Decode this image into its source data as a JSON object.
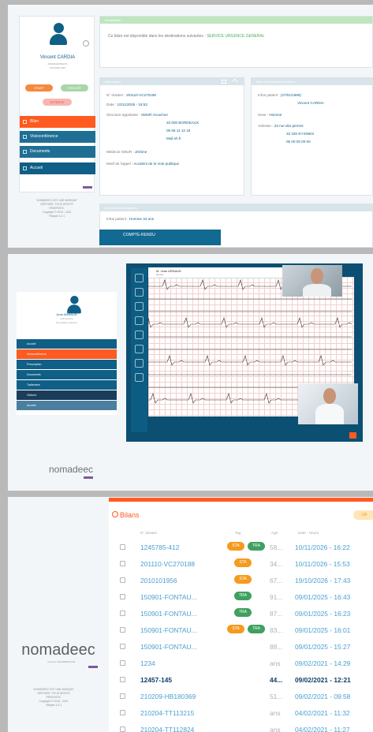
{
  "panel1": {
    "user": {
      "name": "Vincent CARDIA",
      "sub1": "ADDDEHERSHOS",
      "sub2": "INHASNE 2MS"
    },
    "badges": {
      "staff": "STAFF",
      "proute": "PROUTE",
      "attente": "ATTENTE"
    },
    "nav": [
      "Bilan",
      "Visioconférence",
      "Documents",
      "Accueil"
    ],
    "legal": [
      "NOMADEEC EST UNE MARQUE",
      "DÉPOSÉE. TOUS DROITS",
      "RÉSERVÉS.",
      "Copyright © 2015 - 2021",
      "Tellipart 1.0.1"
    ],
    "destination": {
      "header": "Destination",
      "text": "Ce bilan est disponible dans les destinations suivantes :",
      "value": "SERVICE URGENCE GENERAL"
    },
    "bilan": {
      "header": "Bilan appel",
      "dossier_label": "N° dossier :",
      "dossier": "201110-VC270188",
      "date_label": "Date :",
      "date": "10/11/2026 - 15:53",
      "structure_label": "Structure appelante :",
      "structure_lines": [
        "SMUR Arcachon",
        "33 000 BORDEAUX",
        "05 56 11 12 18",
        "Mail.sh.fr"
      ],
      "medecin_label": "Médecin SMUR :",
      "medecin": "Jérôme",
      "motif_label": "Motif de l'appel :",
      "motif": "Accident de la Voie publique"
    },
    "admin": {
      "header": "Infos administratives patient",
      "infos_label": "Infos patient :",
      "infos": "(27/01/1986)",
      "name": "Vincent CARDIA",
      "sexe_label": "Sexe :",
      "sexe": "Homme",
      "adresse_label": "Adresse :",
      "adresse_lines": [
        "23 rue des pierres",
        "33 320 EYSINES",
        "05 00 00 00 00"
      ]
    },
    "medical": {
      "header": "Infos médicales patient",
      "infos_label": "Infos patient :",
      "infos": "Homme 34 ans"
    },
    "compte_rendu": "COMPTE-RENDU"
  },
  "panel2": {
    "user": {
      "name": "Jean ARNAUD",
      "sub1": "Infirmier/ère",
      "sub2": "Nomadeec Urgence"
    },
    "nav": [
      "Accueil",
      "Visioconférence",
      "Prescription",
      "Documents",
      "Traitement",
      "Clôturer",
      "Accueil"
    ],
    "patient_name": "M. Jean ARNAUD",
    "patient_sub": "34 ans",
    "logo": "nomadeec"
  },
  "panel3": {
    "logo": "nomadeec",
    "logo_sub": "Express TELEMEDECINE",
    "legal": [
      "NOMADEEC EST UNE MARQUE",
      "DÉPOSÉE. TOUS DROITS",
      "RÉSERVÉS.",
      "Copyright © 2015 - 2021",
      "Tellipart 1.0.1"
    ],
    "title": "Bilans",
    "urgent_btn": "UR",
    "columns": {
      "num": "N° dossier",
      "tag": "Tag",
      "age": "Age",
      "date": "Date - Heure"
    },
    "rows": [
      {
        "num": "1245785-412",
        "tags": [
          "STA",
          "TRA"
        ],
        "age": "58...",
        "date": "10/11/2026 - 16:22",
        "bold": false
      },
      {
        "num": "201110-VC270188",
        "tags": [
          "STA"
        ],
        "age": "34...",
        "date": "10/11/2026 - 15:53",
        "bold": false
      },
      {
        "num": "2010101956",
        "tags": [
          "STA"
        ],
        "age": "67...",
        "date": "19/10/2026 - 17:43",
        "bold": false
      },
      {
        "num": "150901-FONTAU...",
        "tags": [
          "TRA"
        ],
        "age": "91...",
        "date": "09/01/2025 - 16:43",
        "bold": false
      },
      {
        "num": "150901-FONTAU...",
        "tags": [
          "TRA"
        ],
        "age": "87...",
        "date": "09/01/2025 - 16:23",
        "bold": false
      },
      {
        "num": "150901-FONTAU...",
        "tags": [
          "STA",
          "TRA"
        ],
        "age": "83...",
        "date": "09/01/2025 - 16:01",
        "bold": false
      },
      {
        "num": "150901-FONTAU...",
        "tags": [],
        "age": "88...",
        "date": "09/01/2025 - 15:27",
        "bold": false
      },
      {
        "num": "1234",
        "tags": [],
        "age": "ans",
        "date": "09/02/2021 - 14:29",
        "bold": false
      },
      {
        "num": "12457-145",
        "tags": [],
        "age": "44...",
        "date": "09/02/2021 - 12:21",
        "bold": true
      },
      {
        "num": "210209-HB180369",
        "tags": [],
        "age": "51...",
        "date": "09/02/2021 - 09:58",
        "bold": false
      },
      {
        "num": "210204-TT113215",
        "tags": [],
        "age": "ans",
        "date": "04/02/2021 - 11:32",
        "bold": false
      },
      {
        "num": "210204-TT112824",
        "tags": [],
        "age": "ans",
        "date": "04/02/2021 - 11:27",
        "bold": false
      }
    ]
  },
  "colors": {
    "brand": "#0f5f86",
    "accent": "#ff5a1f",
    "sta": "#f59a1e",
    "tra": "#3fa05f",
    "link": "#4aa0cf"
  },
  "icons": [
    "user-avatar-icon",
    "info-icon",
    "document-icon",
    "camera-icon",
    "folder-icon",
    "home-icon",
    "print-icon",
    "collapse-icon",
    "checkbox-icon",
    "bilans-icon"
  ]
}
